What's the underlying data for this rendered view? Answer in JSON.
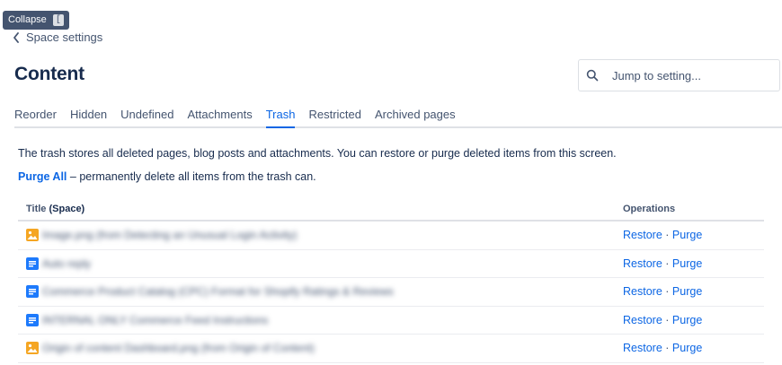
{
  "tooltip": {
    "label": "Collapse",
    "shortcut": "["
  },
  "back": {
    "label": "Space settings"
  },
  "page": {
    "title": "Content"
  },
  "search": {
    "placeholder": "Jump to setting..."
  },
  "tabs": [
    {
      "label": "Reorder",
      "active": false
    },
    {
      "label": "Hidden",
      "active": false
    },
    {
      "label": "Undefined",
      "active": false
    },
    {
      "label": "Attachments",
      "active": false
    },
    {
      "label": "Trash",
      "active": true
    },
    {
      "label": "Restricted",
      "active": false
    },
    {
      "label": "Archived pages",
      "active": false
    }
  ],
  "intro": "The trash stores all deleted pages, blog posts and attachments. You can restore or purge deleted items from this screen.",
  "purge": {
    "link": "Purge All",
    "description": "– permanently delete all items from the trash can."
  },
  "table": {
    "header_title": "Title",
    "header_space": "(Space)",
    "header_ops": "Operations",
    "rows": [
      {
        "icon": "image-icon",
        "title": "Image.png (from Detecting an Unusual Login Activity)",
        "restore": "Restore",
        "separator": "·",
        "purge": "Purge"
      },
      {
        "icon": "page-icon",
        "title": "Auto reply",
        "restore": "Restore",
        "separator": "·",
        "purge": "Purge"
      },
      {
        "icon": "page-icon",
        "title": "Commerce Product Catalog (CPC) Format for Shopify Ratings & Reviews",
        "restore": "Restore",
        "separator": "·",
        "purge": "Purge"
      },
      {
        "icon": "page-icon",
        "title": "INTERNAL ONLY Commerce Feed Instructions",
        "restore": "Restore",
        "separator": "·",
        "purge": "Purge"
      },
      {
        "icon": "image-icon",
        "title": "Origin of content Dashboard.png (from Origin of Content)",
        "restore": "Restore",
        "separator": "·",
        "purge": "Purge"
      }
    ]
  },
  "colors": {
    "accent": "#0c66e4",
    "image_icon": "#f5a623",
    "page_icon": "#1d7afc",
    "text": "#172b4d",
    "subtle": "#44546f"
  }
}
